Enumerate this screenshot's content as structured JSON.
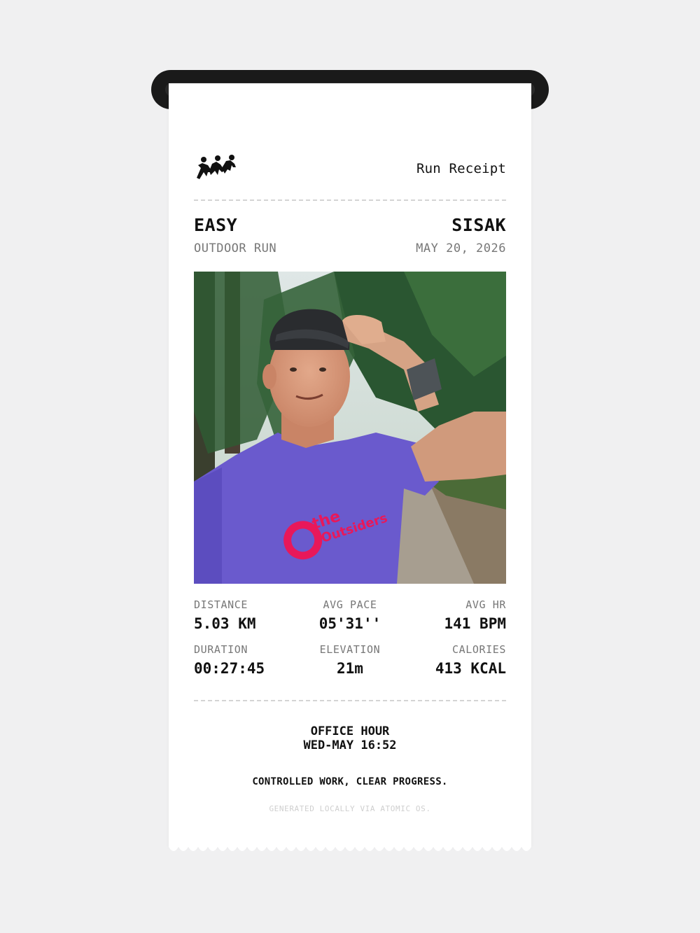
{
  "receipt": {
    "logo_icon": "runners-logo-icon",
    "title": "Run Receipt",
    "run_type": "EASY",
    "location": "SISAK",
    "category": "OUTDOOR RUN",
    "date": "MAY 20, 2026",
    "photo_shirt_text": {
      "line1": "the",
      "line2": "Outsiders"
    },
    "stats": [
      {
        "label": "DISTANCE",
        "value": "5.03 KM"
      },
      {
        "label": "AVG PACE",
        "value": "05'31''"
      },
      {
        "label": "AVG HR",
        "value": "141 BPM"
      },
      {
        "label": "DURATION",
        "value": "00:27:45"
      },
      {
        "label": "ELEVATION",
        "value": "21m"
      },
      {
        "label": "CALORIES",
        "value": "413 KCAL"
      }
    ],
    "footer_title": "OFFICE HOUR",
    "footer_time": "WED-MAY 16:52",
    "tagline": "CONTROLLED WORK, CLEAR PROGRESS.",
    "generated": "GENERATED LOCALLY VIA ATOMIC OS."
  },
  "colors": {
    "background": "#f0f0f1",
    "paper": "#ffffff",
    "printer": "#1a1a1a",
    "shirt": "#6a5acd",
    "logo_pink": "#e8185a"
  }
}
